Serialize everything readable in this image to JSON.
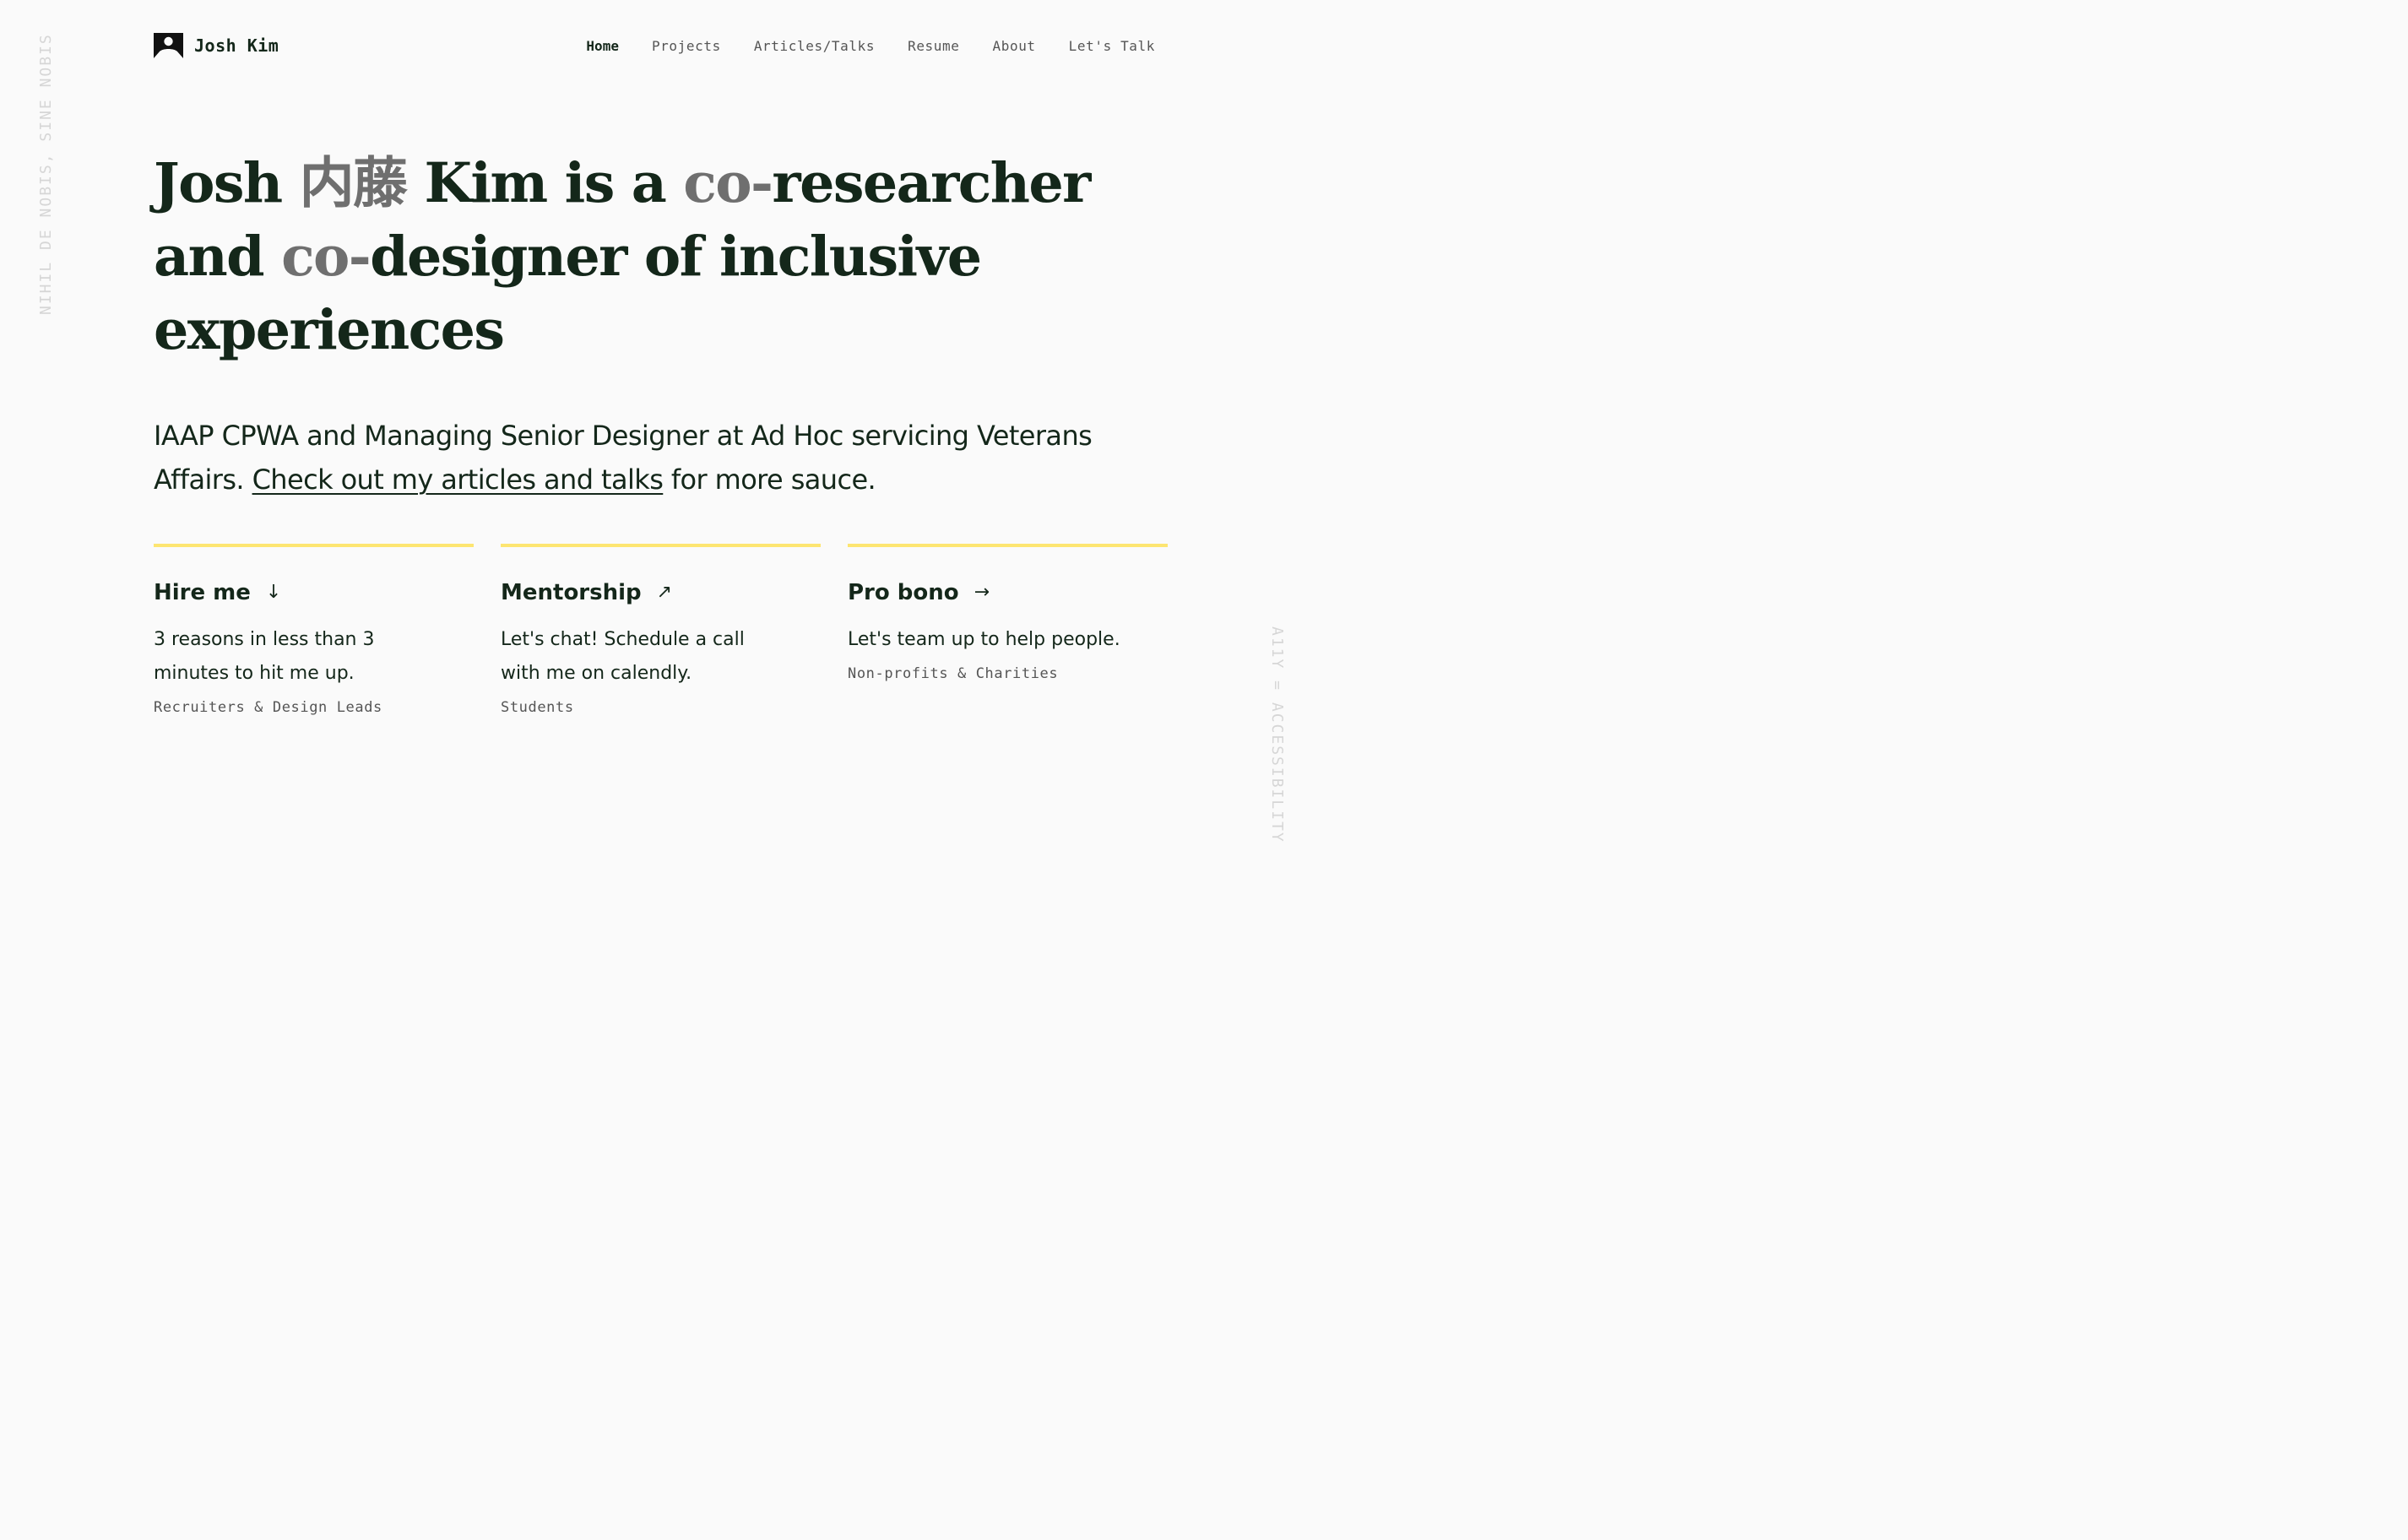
{
  "side": {
    "left_text": "NIHIL DE NOBIS, SINE NOBIS",
    "right_text": "A11Y = ACCESSIBILITY"
  },
  "header": {
    "brand": "Josh Kim",
    "logo_icon": "person-frame-icon",
    "nav": [
      {
        "label": "Home",
        "active": true
      },
      {
        "label": "Projects"
      },
      {
        "label": "Articles/Talks"
      },
      {
        "label": "Resume"
      },
      {
        "label": "About"
      },
      {
        "label": "Let's Talk"
      }
    ]
  },
  "hero": {
    "name_first": "Josh",
    "name_cjk": "内藤",
    "name_last": "Kim is a",
    "co1": "co-",
    "word1": "researcher",
    "and": "and",
    "co2": "co-",
    "rest": "designer of inclusive experiences"
  },
  "intro": {
    "text_before": "IAAP CPWA and Managing Senior Designer at Ad Hoc servicing Veterans Affairs.",
    "link": "Check out my articles and talks",
    "text_after": "for more sauce."
  },
  "cards": [
    {
      "title": "Hire me",
      "arrow_icon": "arrow-down-icon",
      "arrow": "↓",
      "body": "3 reasons in less than 3 minutes to hit me up.",
      "tag": "Recruiters & Design Leads"
    },
    {
      "title": "Mentorship",
      "arrow_icon": "arrow-up-right-icon",
      "arrow": "↗",
      "body": "Let's chat! Schedule a call with me on calendly.",
      "tag": "Students"
    },
    {
      "title": "Pro bono",
      "arrow_icon": "arrow-right-icon",
      "arrow": "→",
      "body": "Let's team up to help people.",
      "tag": "Non-profits & Charities"
    }
  ],
  "colors": {
    "background": "#fafafa",
    "text": "#14271a",
    "muted": "#6f6f6f",
    "accent": "#fde571"
  }
}
